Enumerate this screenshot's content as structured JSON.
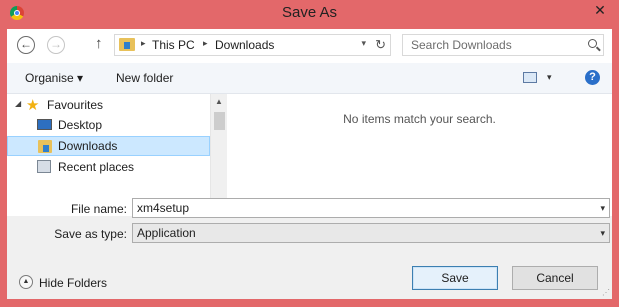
{
  "window": {
    "title": "Save As",
    "close_glyph": "✕"
  },
  "address": {
    "crumbs": [
      "This PC",
      "Downloads"
    ],
    "separator": "▸",
    "dropdown_glyph": "▾",
    "refresh_glyph": "↻"
  },
  "nav_buttons": {
    "back": "←",
    "forward": "→",
    "up": "↑"
  },
  "search": {
    "placeholder": "Search Downloads"
  },
  "toolbar": {
    "organise": "Organise ▾",
    "new_folder": "New folder",
    "view_dropdown": "▾",
    "help": "?"
  },
  "nav_pane": {
    "items": [
      {
        "label": "Favourites"
      },
      {
        "label": "Desktop"
      },
      {
        "label": "Downloads"
      },
      {
        "label": "Recent places"
      }
    ],
    "expand_glyph": "◢",
    "star_glyph": "★"
  },
  "scrollbar": {
    "up": "▲",
    "down": "▼"
  },
  "content": {
    "empty_message": "No items match your search."
  },
  "form": {
    "file_name_label": "File name:",
    "file_name_value": "xm4setup",
    "save_type_label": "Save as type:",
    "save_type_value": "Application",
    "dropdown_glyph": "▾"
  },
  "footer": {
    "hide_folders": "Hide Folders",
    "hide_glyph": "▲",
    "save": "Save",
    "cancel": "Cancel"
  },
  "colors": {
    "frame": "#e3686a",
    "selection": "#cce8ff",
    "accent": "#3c7fb1"
  }
}
